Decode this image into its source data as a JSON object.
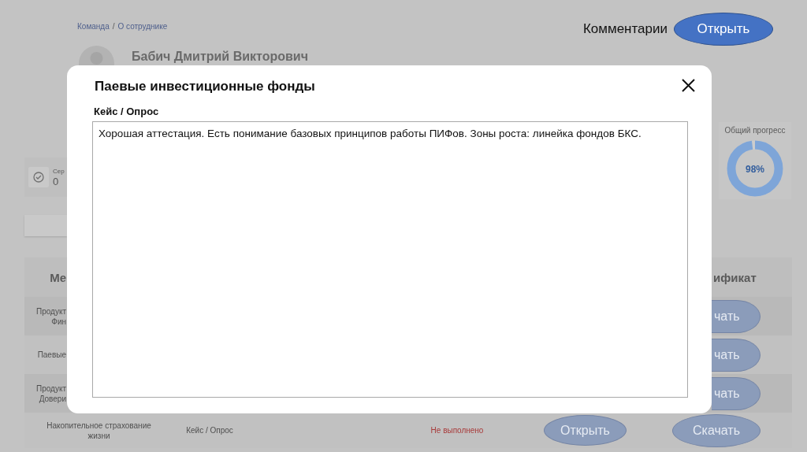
{
  "breadcrumb": {
    "items": [
      "Команда",
      "О сотруднике"
    ],
    "separator": "/"
  },
  "employee": {
    "name": "Бабич Дмитрий Викторович"
  },
  "comments": {
    "label": "Комментарии",
    "button": "Открыть"
  },
  "stat_card": {
    "label": "Сер",
    "value": "0"
  },
  "progress": {
    "title": "Общий прогресс",
    "level": 0.98,
    "reading": "98%"
  },
  "table": {
    "columns": [
      {
        "label": "Ме"
      },
      {
        "label": "ификат"
      }
    ],
    "rows": [
      {
        "kind": "covered",
        "column_1": [
          "Продукт",
          "Фин"
        ],
        "certificate_button": "чать"
      },
      {
        "kind": "covered",
        "column_1": [
          "Паевые"
        ],
        "certificate_button": "чать"
      },
      {
        "kind": "covered",
        "column_1": [
          "Продукт",
          "Довери"
        ],
        "certificate_button": "чать"
      },
      {
        "kind": "full",
        "name": "Накопительное страхование жизни",
        "format": "Кейс / Опрос",
        "status": "Не выполнено",
        "open_button": "Открыть",
        "certificate_button": "Скачать"
      }
    ]
  },
  "modal": {
    "title": "Паевые инвестиционные фонды",
    "field_label": "Кейс / Опрос",
    "comment": "Хорошая аттестация. Есть понимание базовых принципов работы ПИФов. Зоны роста: линейка фондов БКС."
  }
}
